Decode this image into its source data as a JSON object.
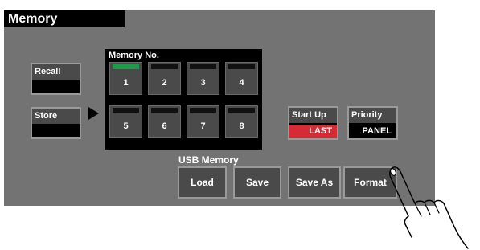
{
  "title": "Memory",
  "recall": {
    "label": "Recall",
    "value": ""
  },
  "store": {
    "label": "Store",
    "value": ""
  },
  "memory": {
    "title": "Memory No.",
    "slots": [
      {
        "number": "1",
        "active": true
      },
      {
        "number": "2",
        "active": false
      },
      {
        "number": "3",
        "active": false
      },
      {
        "number": "4",
        "active": false
      },
      {
        "number": "5",
        "active": false
      },
      {
        "number": "6",
        "active": false
      },
      {
        "number": "7",
        "active": false
      },
      {
        "number": "8",
        "active": false
      }
    ]
  },
  "startup": {
    "label": "Start Up",
    "value": "LAST"
  },
  "priority": {
    "label": "Priority",
    "value": "PANEL"
  },
  "usb": {
    "label": "USB Memory",
    "buttons": [
      "Load",
      "Save",
      "Save As",
      "Format"
    ]
  },
  "colors": {
    "panel": "#737373",
    "active_indicator": "#1f9a4a",
    "startup_value_bg": "#d62a35"
  },
  "icons": [
    "play-arrow-icon",
    "pointing-hand-icon"
  ]
}
